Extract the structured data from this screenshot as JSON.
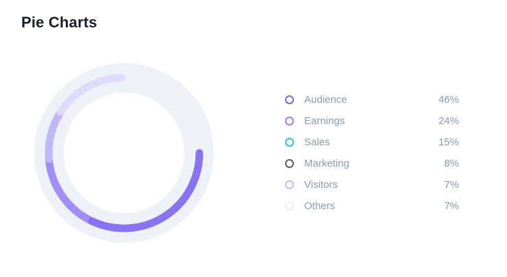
{
  "title": "Pie Charts",
  "chart_data": {
    "type": "pie",
    "style": "donut-ring",
    "title": "Pie Charts",
    "categories": [
      "Audience",
      "Earnings",
      "Sales",
      "Marketing",
      "Visitors",
      "Others"
    ],
    "values": [
      46,
      24,
      15,
      8,
      7,
      7
    ],
    "value_labels": [
      "46%",
      "24%",
      "15%",
      "8%",
      "7%",
      "7%"
    ],
    "unit": "%",
    "legend_placement": "right",
    "ring_colors": [
      "#8a73f2",
      "#a18ff5",
      "#c2b7f8",
      "#e1dbfb"
    ],
    "track_color": "#eef1f7",
    "legend_colors": [
      "#7b65e6",
      "#b07be8",
      "#2ec4d8",
      "#5c5d66",
      "#d5b6f0",
      "#eceef3"
    ]
  }
}
